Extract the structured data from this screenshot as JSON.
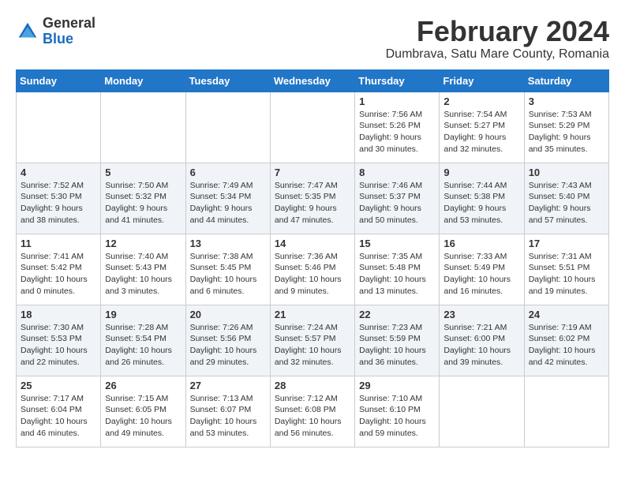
{
  "logo": {
    "general": "General",
    "blue": "Blue"
  },
  "header": {
    "month": "February 2024",
    "location": "Dumbrava, Satu Mare County, Romania"
  },
  "weekdays": [
    "Sunday",
    "Monday",
    "Tuesday",
    "Wednesday",
    "Thursday",
    "Friday",
    "Saturday"
  ],
  "weeks": [
    [
      {
        "day": "",
        "info": ""
      },
      {
        "day": "",
        "info": ""
      },
      {
        "day": "",
        "info": ""
      },
      {
        "day": "",
        "info": ""
      },
      {
        "day": "1",
        "info": "Sunrise: 7:56 AM\nSunset: 5:26 PM\nDaylight: 9 hours\nand 30 minutes."
      },
      {
        "day": "2",
        "info": "Sunrise: 7:54 AM\nSunset: 5:27 PM\nDaylight: 9 hours\nand 32 minutes."
      },
      {
        "day": "3",
        "info": "Sunrise: 7:53 AM\nSunset: 5:29 PM\nDaylight: 9 hours\nand 35 minutes."
      }
    ],
    [
      {
        "day": "4",
        "info": "Sunrise: 7:52 AM\nSunset: 5:30 PM\nDaylight: 9 hours\nand 38 minutes."
      },
      {
        "day": "5",
        "info": "Sunrise: 7:50 AM\nSunset: 5:32 PM\nDaylight: 9 hours\nand 41 minutes."
      },
      {
        "day": "6",
        "info": "Sunrise: 7:49 AM\nSunset: 5:34 PM\nDaylight: 9 hours\nand 44 minutes."
      },
      {
        "day": "7",
        "info": "Sunrise: 7:47 AM\nSunset: 5:35 PM\nDaylight: 9 hours\nand 47 minutes."
      },
      {
        "day": "8",
        "info": "Sunrise: 7:46 AM\nSunset: 5:37 PM\nDaylight: 9 hours\nand 50 minutes."
      },
      {
        "day": "9",
        "info": "Sunrise: 7:44 AM\nSunset: 5:38 PM\nDaylight: 9 hours\nand 53 minutes."
      },
      {
        "day": "10",
        "info": "Sunrise: 7:43 AM\nSunset: 5:40 PM\nDaylight: 9 hours\nand 57 minutes."
      }
    ],
    [
      {
        "day": "11",
        "info": "Sunrise: 7:41 AM\nSunset: 5:42 PM\nDaylight: 10 hours\nand 0 minutes."
      },
      {
        "day": "12",
        "info": "Sunrise: 7:40 AM\nSunset: 5:43 PM\nDaylight: 10 hours\nand 3 minutes."
      },
      {
        "day": "13",
        "info": "Sunrise: 7:38 AM\nSunset: 5:45 PM\nDaylight: 10 hours\nand 6 minutes."
      },
      {
        "day": "14",
        "info": "Sunrise: 7:36 AM\nSunset: 5:46 PM\nDaylight: 10 hours\nand 9 minutes."
      },
      {
        "day": "15",
        "info": "Sunrise: 7:35 AM\nSunset: 5:48 PM\nDaylight: 10 hours\nand 13 minutes."
      },
      {
        "day": "16",
        "info": "Sunrise: 7:33 AM\nSunset: 5:49 PM\nDaylight: 10 hours\nand 16 minutes."
      },
      {
        "day": "17",
        "info": "Sunrise: 7:31 AM\nSunset: 5:51 PM\nDaylight: 10 hours\nand 19 minutes."
      }
    ],
    [
      {
        "day": "18",
        "info": "Sunrise: 7:30 AM\nSunset: 5:53 PM\nDaylight: 10 hours\nand 22 minutes."
      },
      {
        "day": "19",
        "info": "Sunrise: 7:28 AM\nSunset: 5:54 PM\nDaylight: 10 hours\nand 26 minutes."
      },
      {
        "day": "20",
        "info": "Sunrise: 7:26 AM\nSunset: 5:56 PM\nDaylight: 10 hours\nand 29 minutes."
      },
      {
        "day": "21",
        "info": "Sunrise: 7:24 AM\nSunset: 5:57 PM\nDaylight: 10 hours\nand 32 minutes."
      },
      {
        "day": "22",
        "info": "Sunrise: 7:23 AM\nSunset: 5:59 PM\nDaylight: 10 hours\nand 36 minutes."
      },
      {
        "day": "23",
        "info": "Sunrise: 7:21 AM\nSunset: 6:00 PM\nDaylight: 10 hours\nand 39 minutes."
      },
      {
        "day": "24",
        "info": "Sunrise: 7:19 AM\nSunset: 6:02 PM\nDaylight: 10 hours\nand 42 minutes."
      }
    ],
    [
      {
        "day": "25",
        "info": "Sunrise: 7:17 AM\nSunset: 6:04 PM\nDaylight: 10 hours\nand 46 minutes."
      },
      {
        "day": "26",
        "info": "Sunrise: 7:15 AM\nSunset: 6:05 PM\nDaylight: 10 hours\nand 49 minutes."
      },
      {
        "day": "27",
        "info": "Sunrise: 7:13 AM\nSunset: 6:07 PM\nDaylight: 10 hours\nand 53 minutes."
      },
      {
        "day": "28",
        "info": "Sunrise: 7:12 AM\nSunset: 6:08 PM\nDaylight: 10 hours\nand 56 minutes."
      },
      {
        "day": "29",
        "info": "Sunrise: 7:10 AM\nSunset: 6:10 PM\nDaylight: 10 hours\nand 59 minutes."
      },
      {
        "day": "",
        "info": ""
      },
      {
        "day": "",
        "info": ""
      }
    ]
  ]
}
